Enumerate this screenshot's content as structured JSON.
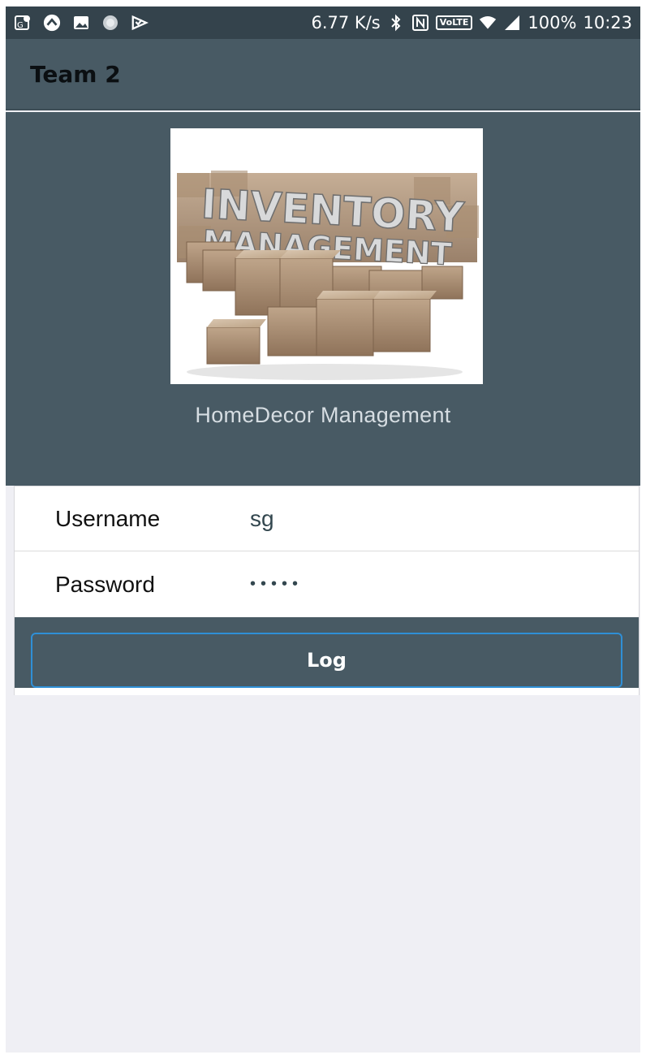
{
  "statusbar": {
    "speed": "6.77 K/s",
    "volte": "VoLTE",
    "battery": "100%",
    "time": "10:23",
    "icons": [
      "maps-notification-icon",
      "arrow-up-circle-icon",
      "gallery-icon",
      "spinner-icon",
      "checklist-icon",
      "bluetooth-icon",
      "nfc-icon",
      "wifi-icon",
      "signal-icon"
    ]
  },
  "header": {
    "title": "Team 2"
  },
  "hero": {
    "logo_text": [
      "INVENTORY",
      "MANAGEMENT"
    ],
    "app_name": "HomeDecor Management"
  },
  "form": {
    "username_label": "Username",
    "username_value": "sg",
    "password_label": "Password",
    "password_value": "•••••",
    "log_label": "Log"
  },
  "colors": {
    "header_bg": "#485a64",
    "statusbar_bg": "#34434c",
    "page_bg": "#efeff4",
    "button_border": "#2f8fd6"
  }
}
